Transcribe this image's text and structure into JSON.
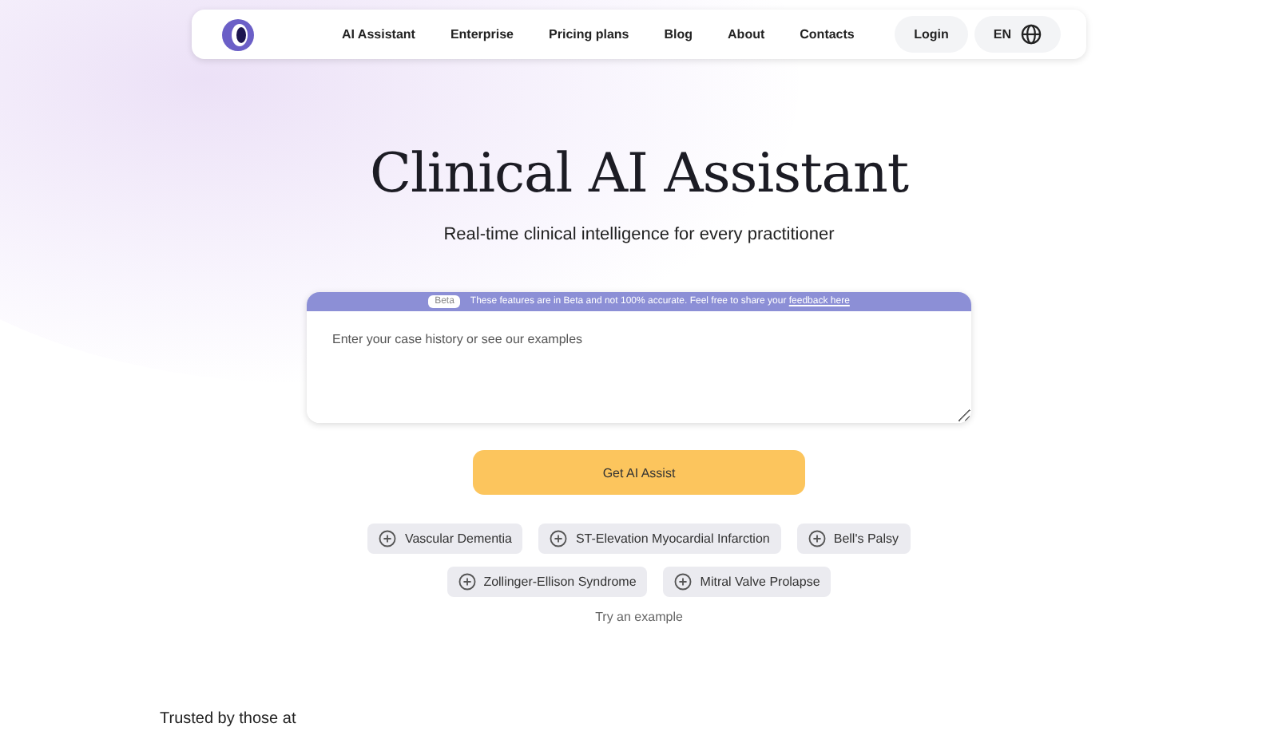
{
  "nav": {
    "links": [
      "AI Assistant",
      "Enterprise",
      "Pricing plans",
      "Blog",
      "About",
      "Contacts"
    ],
    "login": "Login",
    "language": "EN"
  },
  "hero": {
    "title": "Clinical AI Assistant",
    "subtitle": "Real-time clinical intelligence for every practitioner"
  },
  "input_card": {
    "badge": "Beta",
    "notice": "These features are in Beta and not 100% accurate. Feel free to share your",
    "notice_link": "feedback here",
    "placeholder": "Enter your case history or see our examples"
  },
  "submit_button": "Get AI Assist",
  "examples": {
    "rows": [
      [
        "Vascular Dementia",
        "ST-Elevation Myocardial Infarction",
        "Bell's Palsy"
      ],
      [
        "Zollinger-Ellison Syndrome",
        "Mitral Valve Prolapse"
      ]
    ],
    "caption": "Try an example"
  },
  "trusted": "Trusted by those at"
}
